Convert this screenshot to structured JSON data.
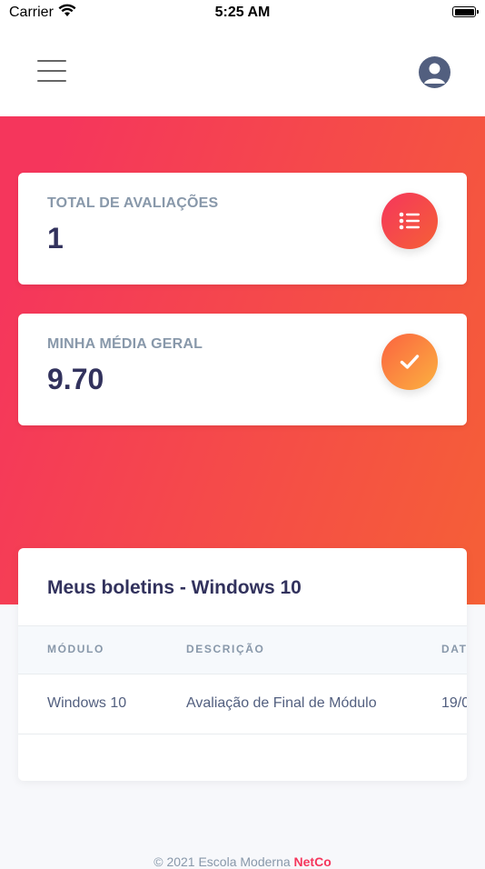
{
  "status_bar": {
    "carrier": "Carrier",
    "time": "5:25 AM"
  },
  "stats": [
    {
      "label": "TOTAL DE AVALIAÇÕES",
      "value": "1",
      "icon": "list-icon"
    },
    {
      "label": "MINHA MÉDIA GERAL",
      "value": "9.70",
      "icon": "check-icon"
    }
  ],
  "boletins": {
    "title": "Meus boletins - Windows 10",
    "columns": [
      "MÓDULO",
      "DESCRIÇÃO",
      "DAT"
    ],
    "rows": [
      {
        "modulo": "Windows 10",
        "descricao": "Avaliação de Final de Módulo",
        "data": "19/0"
      }
    ]
  },
  "footer": {
    "text": "© 2021 Escola Moderna",
    "brand": "NetCo"
  },
  "colors": {
    "accent": "#f5365c",
    "accent2": "#f56036",
    "heading": "#32325d",
    "muted": "#8898aa"
  }
}
